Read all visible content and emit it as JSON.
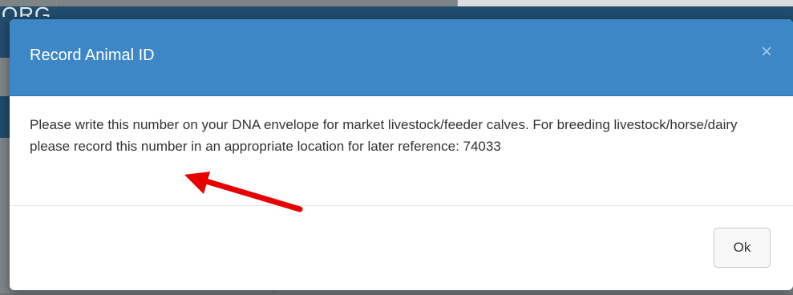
{
  "background": {
    "logo_text": "ORG"
  },
  "modal": {
    "title": "Record Animal ID",
    "close_symbol": "×",
    "body_text": "Please write this number on your DNA envelope for market livestock/feeder calves. For breeding livestock/horse/dairy please record this number in an appropriate location for later reference: 74033",
    "ok_label": "Ok"
  },
  "colors": {
    "header": "#3e87c7",
    "arrow": "#e60000"
  },
  "icons": {
    "close": "close-icon",
    "annotation": "red-arrow-icon"
  }
}
